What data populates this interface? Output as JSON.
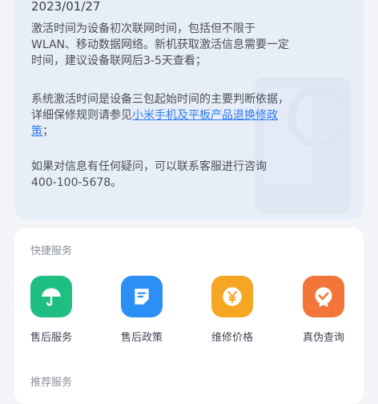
{
  "info_card": {
    "date": "2023/01/27",
    "paragraphs": [
      {
        "lines": [
          "激活时间为设备初次联网时间，包括但不限于",
          "WLAN、移动数据网络。新机获取激活信息需要一定",
          "时间，建议设备联网后3-5天查看；"
        ]
      },
      {
        "lines": [
          "系统激活时间是设备三包起始时间的主要判断依据，",
          "详细保修规则请参见"
        ],
        "link_text_line1": "小米手机及平板产品退换修政",
        "link_text_line2": "策",
        "suffix": "；"
      },
      {
        "lines": [
          "如果对信息有任何疑问，可以联系客服进行咨询",
          "400-100-5678。"
        ]
      }
    ]
  },
  "quick_services": {
    "title": "快捷服务",
    "items": [
      {
        "label": "售后服务",
        "icon": "umbrella-icon",
        "color": "#1fbf84"
      },
      {
        "label": "售后政策",
        "icon": "document-icon",
        "color": "#2b8ff5"
      },
      {
        "label": "维修价格",
        "icon": "yen-coin-icon",
        "color": "#f5a623"
      },
      {
        "label": "真伪查询",
        "icon": "verified-badge-icon",
        "color": "#f2763a"
      }
    ]
  },
  "recommended": {
    "title": "推荐服务"
  }
}
